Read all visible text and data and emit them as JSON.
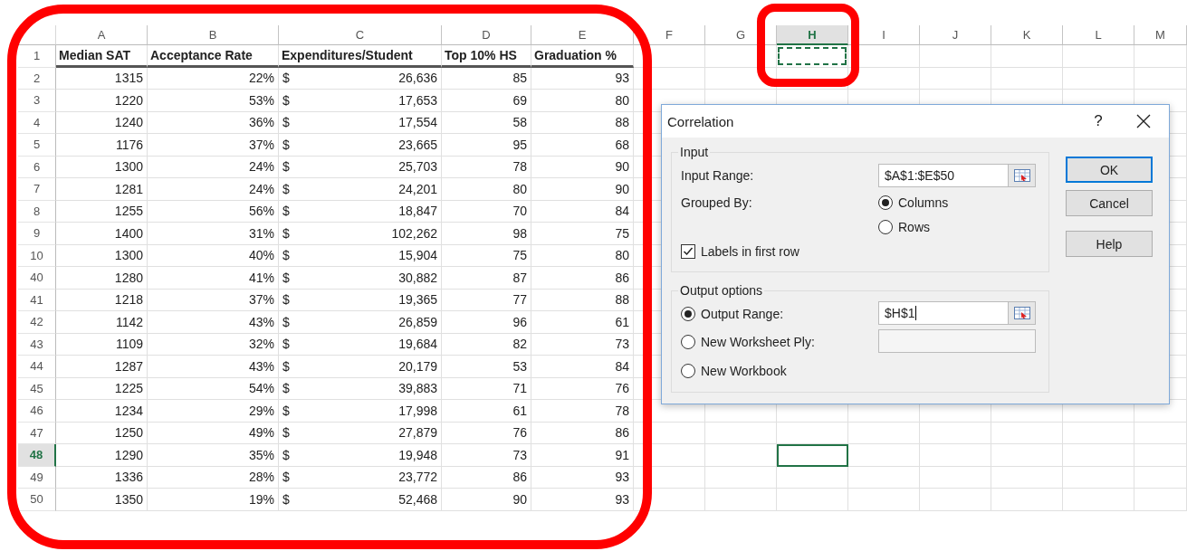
{
  "sheet": {
    "columns": [
      {
        "label": "A",
        "selected": false,
        "marquee": false
      },
      {
        "label": "B",
        "selected": false,
        "marquee": false
      },
      {
        "label": "C",
        "selected": false,
        "marquee": false
      },
      {
        "label": "D",
        "selected": false,
        "marquee": false
      },
      {
        "label": "E",
        "selected": false,
        "marquee": false
      },
      {
        "label": "F",
        "selected": false,
        "marquee": false
      },
      {
        "label": "G",
        "selected": false,
        "marquee": false
      },
      {
        "label": "H",
        "selected": true,
        "marquee": true
      },
      {
        "label": "I",
        "selected": false,
        "marquee": false
      },
      {
        "label": "J",
        "selected": false,
        "marquee": false
      },
      {
        "label": "K",
        "selected": false,
        "marquee": false
      },
      {
        "label": "L",
        "selected": false,
        "marquee": false
      },
      {
        "label": "M",
        "selected": false,
        "marquee": false
      }
    ],
    "rows": [
      {
        "number": "1",
        "kind": "header",
        "selected": false,
        "cells": [
          "Median SAT",
          "Acceptance Rate",
          "Expenditures/Student",
          "Top 10% HS",
          "Graduation %"
        ]
      },
      {
        "number": "2",
        "kind": "data",
        "selected": false,
        "cells": [
          "1315",
          "22%",
          {
            "currency": "$",
            "amount": "26,636"
          },
          "85",
          "93"
        ]
      },
      {
        "number": "3",
        "kind": "data",
        "selected": false,
        "cells": [
          "1220",
          "53%",
          {
            "currency": "$",
            "amount": "17,653"
          },
          "69",
          "80"
        ]
      },
      {
        "number": "4",
        "kind": "data",
        "selected": false,
        "cells": [
          "1240",
          "36%",
          {
            "currency": "$",
            "amount": "17,554"
          },
          "58",
          "88"
        ]
      },
      {
        "number": "5",
        "kind": "data",
        "selected": false,
        "cells": [
          "1176",
          "37%",
          {
            "currency": "$",
            "amount": "23,665"
          },
          "95",
          "68"
        ]
      },
      {
        "number": "6",
        "kind": "data",
        "selected": false,
        "cells": [
          "1300",
          "24%",
          {
            "currency": "$",
            "amount": "25,703"
          },
          "78",
          "90"
        ]
      },
      {
        "number": "7",
        "kind": "data",
        "selected": false,
        "cells": [
          "1281",
          "24%",
          {
            "currency": "$",
            "amount": "24,201"
          },
          "80",
          "90"
        ]
      },
      {
        "number": "8",
        "kind": "data",
        "selected": false,
        "cells": [
          "1255",
          "56%",
          {
            "currency": "$",
            "amount": "18,847"
          },
          "70",
          "84"
        ]
      },
      {
        "number": "9",
        "kind": "data",
        "selected": false,
        "cells": [
          "1400",
          "31%",
          {
            "currency": "$",
            "amount": "102,262"
          },
          "98",
          "75"
        ]
      },
      {
        "number": "10",
        "kind": "data",
        "selected": false,
        "cells": [
          "1300",
          "40%",
          {
            "currency": "$",
            "amount": "15,904"
          },
          "75",
          "80"
        ]
      },
      {
        "number": "40",
        "kind": "data",
        "selected": false,
        "cells": [
          "1280",
          "41%",
          {
            "currency": "$",
            "amount": "30,882"
          },
          "87",
          "86"
        ]
      },
      {
        "number": "41",
        "kind": "data",
        "selected": false,
        "cells": [
          "1218",
          "37%",
          {
            "currency": "$",
            "amount": "19,365"
          },
          "77",
          "88"
        ]
      },
      {
        "number": "42",
        "kind": "data",
        "selected": false,
        "cells": [
          "1142",
          "43%",
          {
            "currency": "$",
            "amount": "26,859"
          },
          "96",
          "61"
        ]
      },
      {
        "number": "43",
        "kind": "data",
        "selected": false,
        "cells": [
          "1109",
          "32%",
          {
            "currency": "$",
            "amount": "19,684"
          },
          "82",
          "73"
        ]
      },
      {
        "number": "44",
        "kind": "data",
        "selected": false,
        "cells": [
          "1287",
          "43%",
          {
            "currency": "$",
            "amount": "20,179"
          },
          "53",
          "84"
        ]
      },
      {
        "number": "45",
        "kind": "data",
        "selected": false,
        "cells": [
          "1225",
          "54%",
          {
            "currency": "$",
            "amount": "39,883"
          },
          "71",
          "76"
        ]
      },
      {
        "number": "46",
        "kind": "data",
        "selected": false,
        "cells": [
          "1234",
          "29%",
          {
            "currency": "$",
            "amount": "17,998"
          },
          "61",
          "78"
        ]
      },
      {
        "number": "47",
        "kind": "data",
        "selected": false,
        "cells": [
          "1250",
          "49%",
          {
            "currency": "$",
            "amount": "27,879"
          },
          "76",
          "86"
        ]
      },
      {
        "number": "48",
        "kind": "data",
        "selected": true,
        "cells": [
          "1290",
          "35%",
          {
            "currency": "$",
            "amount": "19,948"
          },
          "73",
          "91"
        ]
      },
      {
        "number": "49",
        "kind": "data",
        "selected": false,
        "cells": [
          "1336",
          "28%",
          {
            "currency": "$",
            "amount": "23,772"
          },
          "86",
          "93"
        ]
      },
      {
        "number": "50",
        "kind": "data",
        "selected": false,
        "cells": [
          "1350",
          "19%",
          {
            "currency": "$",
            "amount": "52,468"
          },
          "90",
          "93"
        ]
      }
    ]
  },
  "dialog": {
    "title": "Correlation",
    "help": "?",
    "input_group": {
      "legend": "Input",
      "range_label": "Input Range:",
      "range_value": "$A$1:$E$50",
      "grouped_by_label": "Grouped By:",
      "grouped_by_options": [
        {
          "label": "Columns",
          "selected": true
        },
        {
          "label": "Rows",
          "selected": false
        }
      ],
      "labels_checkbox": {
        "label": "Labels in first row",
        "checked": true
      }
    },
    "output_group": {
      "legend": "Output options",
      "options": [
        {
          "label": "Output Range:",
          "selected": true,
          "kind": "field",
          "value": "$H$1",
          "focused": true
        },
        {
          "label": "New Worksheet Ply:",
          "selected": false,
          "kind": "field"
        },
        {
          "label": "New Workbook",
          "selected": false,
          "kind": "plain"
        }
      ]
    },
    "buttons": [
      {
        "label": "OK",
        "default": true
      },
      {
        "label": "Cancel",
        "default": false
      },
      {
        "label": "Help",
        "default": false
      }
    ]
  }
}
